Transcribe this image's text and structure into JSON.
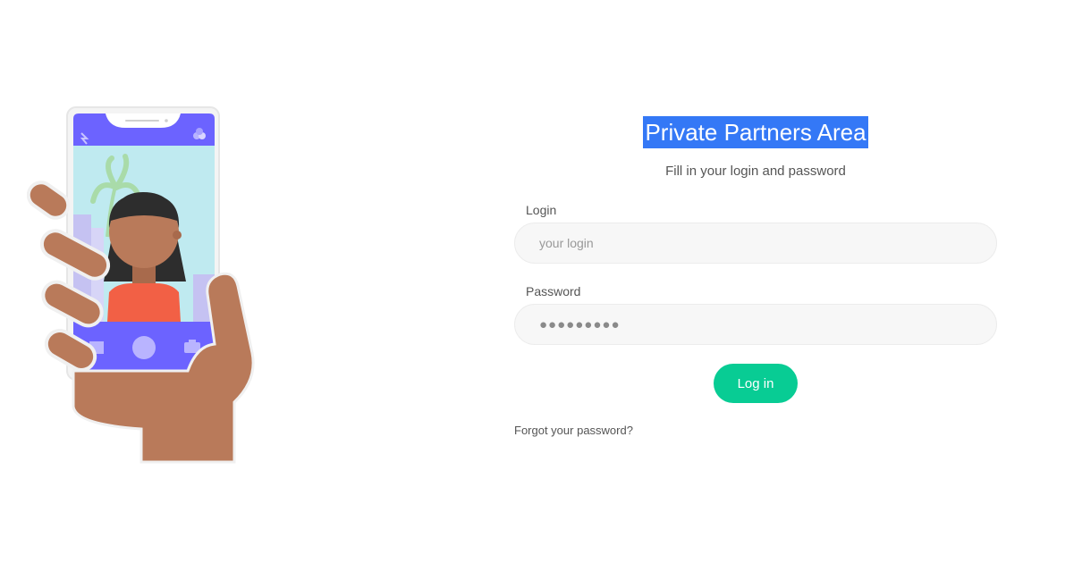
{
  "login_panel": {
    "title": "Private Partners Area",
    "subtitle": "Fill in your login and password",
    "login_label": "Login",
    "login_placeholder": "your login",
    "password_label": "Password",
    "password_value": "●●●●●●●●●",
    "submit_label": "Log in",
    "forgot_link": "Forgot your password?"
  },
  "colors": {
    "title_highlight": "#3478f6",
    "button": "#08cc94",
    "phone_accent": "#6c63ff",
    "skin": "#b97a5a",
    "shirt": "#f26045"
  },
  "illustration": {
    "icons": [
      "hand-holding-phone",
      "selfie-person-icon",
      "camera-icon",
      "shutter-button-icon",
      "gallery-icon"
    ]
  }
}
